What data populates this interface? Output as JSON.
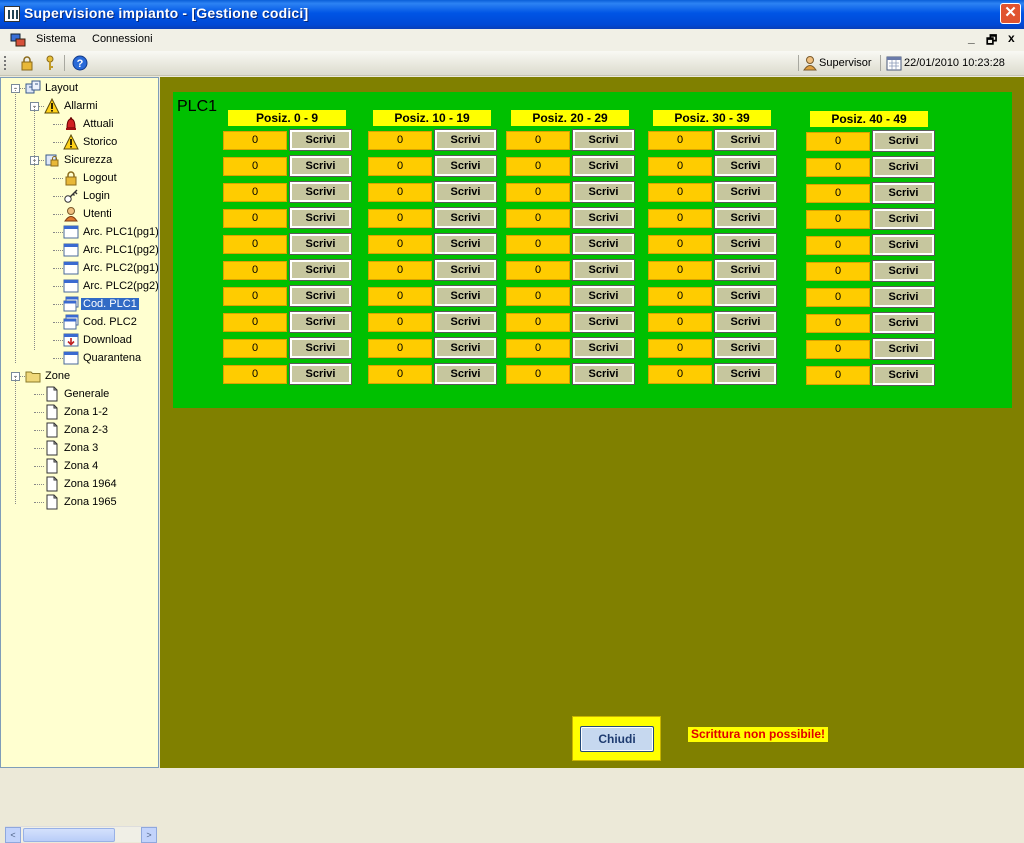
{
  "window": {
    "title": "Supervisione impianto - [Gestione codici]",
    "close_symbol": "✕"
  },
  "menu": {
    "items": [
      "Sistema",
      "Connessioni"
    ],
    "mdi_controls": [
      "_",
      "🗗",
      "x"
    ]
  },
  "toolbar": {
    "icons": [
      "lock-icon",
      "key-icon",
      "help-icon"
    ],
    "user": "Supervisor",
    "datetime": "22/01/2010 10:23:28"
  },
  "tree": {
    "nodes": [
      {
        "label": "Layout",
        "level": 0,
        "icon": "layout-icon",
        "expand": "-"
      },
      {
        "label": "Allarmi",
        "level": 1,
        "icon": "warning-icon",
        "expand": "-"
      },
      {
        "label": "Attuali",
        "level": 2,
        "icon": "bell-alarm-icon",
        "expand": ""
      },
      {
        "label": "Storico",
        "level": 2,
        "icon": "warning-icon",
        "expand": ""
      },
      {
        "label": "Sicurezza",
        "level": 1,
        "icon": "security-icon",
        "expand": "-"
      },
      {
        "label": "Logout",
        "level": 2,
        "icon": "lock-icon",
        "expand": ""
      },
      {
        "label": "Login",
        "level": 2,
        "icon": "key-icon",
        "expand": ""
      },
      {
        "label": "Utenti",
        "level": 2,
        "icon": "user-icon",
        "expand": ""
      },
      {
        "label": "Arc. PLC1(pg1)",
        "level": 2,
        "icon": "window-icon",
        "expand": ""
      },
      {
        "label": "Arc. PLC1(pg2)",
        "level": 2,
        "icon": "window-icon",
        "expand": ""
      },
      {
        "label": "Arc. PLC2(pg1)",
        "level": 2,
        "icon": "window-icon",
        "expand": ""
      },
      {
        "label": "Arc. PLC2(pg2)",
        "level": 2,
        "icon": "window-icon",
        "expand": ""
      },
      {
        "label": "Cod. PLC1",
        "level": 2,
        "icon": "code-window-icon",
        "expand": "",
        "selected": true
      },
      {
        "label": "Cod. PLC2",
        "level": 2,
        "icon": "code-window-icon",
        "expand": ""
      },
      {
        "label": "Download",
        "level": 2,
        "icon": "download-icon",
        "expand": ""
      },
      {
        "label": "Quarantena",
        "level": 2,
        "icon": "window-icon",
        "expand": ""
      },
      {
        "label": "Zone",
        "level": 0,
        "icon": "folder-icon",
        "expand": "-"
      },
      {
        "label": "Generale",
        "level": 1,
        "icon": "document-icon",
        "expand": ""
      },
      {
        "label": "Zona 1-2",
        "level": 1,
        "icon": "document-icon",
        "expand": ""
      },
      {
        "label": "Zona 2-3",
        "level": 1,
        "icon": "document-icon",
        "expand": ""
      },
      {
        "label": "Zona 3",
        "level": 1,
        "icon": "document-icon",
        "expand": ""
      },
      {
        "label": "Zona 4",
        "level": 1,
        "icon": "document-icon",
        "expand": ""
      },
      {
        "label": "Zona 1964",
        "level": 1,
        "icon": "document-icon",
        "expand": ""
      },
      {
        "label": "Zona 1965",
        "level": 1,
        "icon": "document-icon",
        "expand": ""
      }
    ],
    "scroll_left": "<",
    "scroll_right": ">"
  },
  "plc_panel": {
    "title": "PLC1",
    "write_label": "Scrivi",
    "columns": [
      {
        "header": "Posiz. 0 - 9",
        "values": [
          "0",
          "0",
          "0",
          "0",
          "0",
          "0",
          "0",
          "0",
          "0",
          "0"
        ]
      },
      {
        "header": "Posiz. 10 - 19",
        "values": [
          "0",
          "0",
          "0",
          "0",
          "0",
          "0",
          "0",
          "0",
          "0",
          "0"
        ]
      },
      {
        "header": "Posiz. 20 - 29",
        "values": [
          "0",
          "0",
          "0",
          "0",
          "0",
          "0",
          "0",
          "0",
          "0",
          "0"
        ]
      },
      {
        "header": "Posiz. 30 - 39",
        "values": [
          "0",
          "0",
          "0",
          "0",
          "0",
          "0",
          "0",
          "0",
          "0",
          "0"
        ]
      },
      {
        "header": "Posiz. 40 - 49",
        "values": [
          "0",
          "0",
          "0",
          "0",
          "0",
          "0",
          "0",
          "0",
          "0",
          "0"
        ]
      }
    ]
  },
  "footer": {
    "close_label": "Chiudi",
    "warning": "Scrittura non possibile!"
  },
  "colors": {
    "main_background": "#808000",
    "panel_green": "#00c000",
    "value_yellow": "#ffcc00",
    "header_yellow": "#ffff00",
    "warning_red": "#e00000"
  }
}
